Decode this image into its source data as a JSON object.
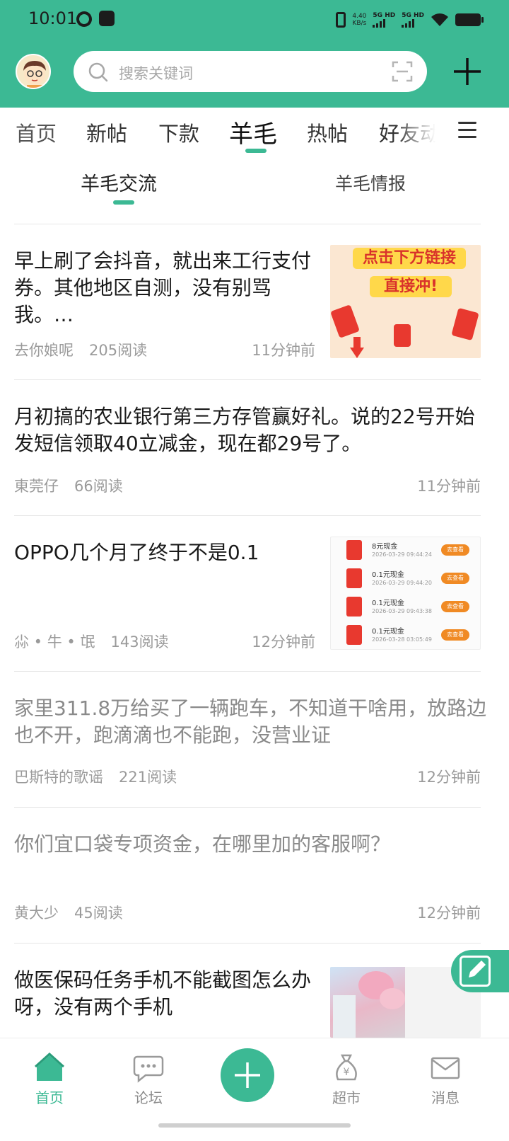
{
  "status_bar": {
    "time": "10:01",
    "net_speed_value": "4.40",
    "net_speed_unit": "KB/s",
    "sim1_label": "5G HD",
    "sim2_label": "5G HD"
  },
  "search": {
    "placeholder": "搜索关键词"
  },
  "channel_tabs": [
    "首页",
    "新帖",
    "下款",
    "羊毛",
    "热帖",
    "好友动"
  ],
  "active_channel": "羊毛",
  "sub_tabs": [
    "羊毛交流",
    "羊毛情报"
  ],
  "active_sub_tab": "羊毛交流",
  "posts": [
    {
      "title": "早上刷了会抖音，就出来工行支付券。其他地区自测，没有别骂我。…",
      "author": "去你娘呢",
      "reads": "205阅读",
      "time": "11分钟前",
      "thumb": {
        "banner_line1": "点击下方链接",
        "banner_line2": "直接冲!"
      }
    },
    {
      "title": "月初搞的农业银行第三方存管赢好礼。说的22号开始发短信领取40立减金，现在都29号了。",
      "author": "東莞仔",
      "reads": "66阅读",
      "time": "11分钟前"
    },
    {
      "title": "OPPO几个月了终于不是0.1",
      "author": "尛 • 牛 • 氓",
      "reads": "143阅读",
      "time": "12分钟前",
      "thumb": {
        "rows": [
          {
            "label": "8元现金",
            "date": "2026-03-29 09:44:24",
            "button": "去查看"
          },
          {
            "label": "0.1元现金",
            "date": "2026-03-29 09:44:20",
            "button": "去查看"
          },
          {
            "label": "0.1元现金",
            "date": "2026-03-29 09:43:38",
            "button": "去查看"
          },
          {
            "label": "0.1元现金",
            "date": "2026-03-28 03:05:49",
            "button": "去查看"
          }
        ]
      }
    },
    {
      "title": "家里311.8万给买了一辆跑车，不知道干啥用，放路边也不开，跑滴滴也不能跑，没营业证",
      "author": "巴斯特的歌谣",
      "reads": "221阅读",
      "time": "12分钟前"
    },
    {
      "title": "你们宜口袋专项资金，在哪里加的客服啊？",
      "author": "黄大少",
      "reads": "45阅读",
      "time": "12分钟前"
    },
    {
      "title": "做医保码任务手机不能截图怎么办呀，没有两个手机",
      "author": "",
      "reads": "",
      "time": ""
    }
  ],
  "bottom_nav": {
    "home": "首页",
    "forum": "论坛",
    "market": "超市",
    "messages": "消息",
    "active": "首页"
  },
  "colors": {
    "brand_green": "#3cb994",
    "text_primary": "#1a1a1a",
    "text_secondary": "#9a9a9a",
    "accent_red": "#e8392f",
    "accent_orange": "#f08a24"
  }
}
